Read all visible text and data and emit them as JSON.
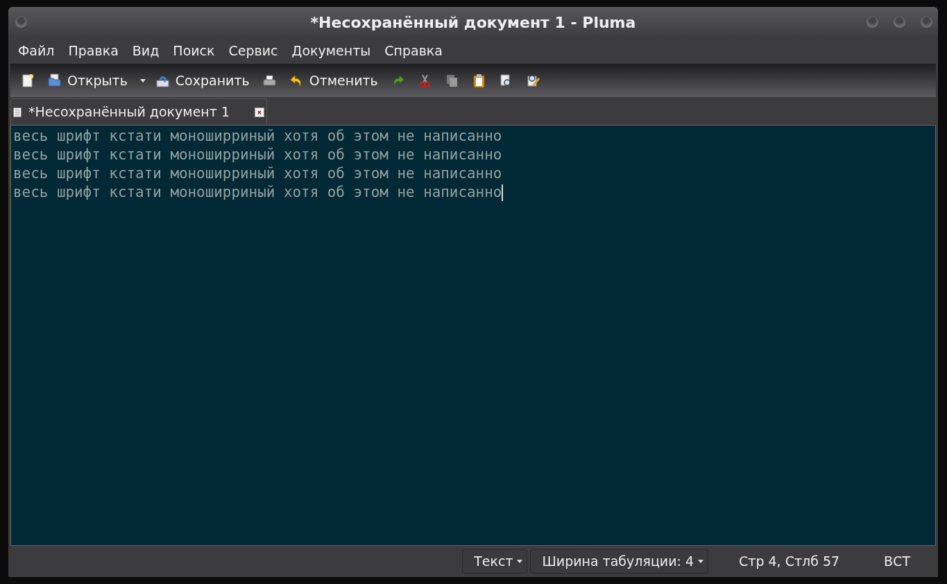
{
  "window": {
    "title": "*Несохранённый документ 1 - Pluma"
  },
  "menu": [
    "Файл",
    "Правка",
    "Вид",
    "Поиск",
    "Сервис",
    "Документы",
    "Справка"
  ],
  "toolbar": [
    {
      "kind": "icon"
    },
    {
      "kind": "labeled",
      "label": "Открыть",
      "dropdown": true
    },
    {
      "kind": "labeled",
      "label": "Сохранить",
      "dropdown": false
    },
    {
      "kind": "icon"
    },
    {
      "kind": "labeled",
      "label": "Отменить",
      "dropdown": false
    },
    {
      "kind": "icon"
    },
    {
      "kind": "icon"
    },
    {
      "kind": "icon"
    },
    {
      "kind": "icon"
    },
    {
      "kind": "icon"
    },
    {
      "kind": "icon"
    }
  ],
  "tabs": [
    {
      "label": "*Несохранённый документ 1",
      "selected": true
    }
  ],
  "editor": {
    "lines": [
      "весь шрифт кстати моноширриный хотя об этом не написанно",
      "весь шрифт кстати моноширриный хотя об этом не написанно",
      "весь шрифт кстати моноширриный хотя об этом не написанно",
      "весь шрифт кстати моноширриный хотя об этом не написанно"
    ]
  },
  "status_bar": [
    {
      "kind": "dropdown",
      "text": "Текст"
    },
    {
      "kind": "dropdown",
      "text": "Ширина табуляции: 4"
    },
    {
      "kind": "text",
      "text": "Стр 4, Стлб 57"
    },
    {
      "kind": "text",
      "text": "ВСТ"
    }
  ]
}
